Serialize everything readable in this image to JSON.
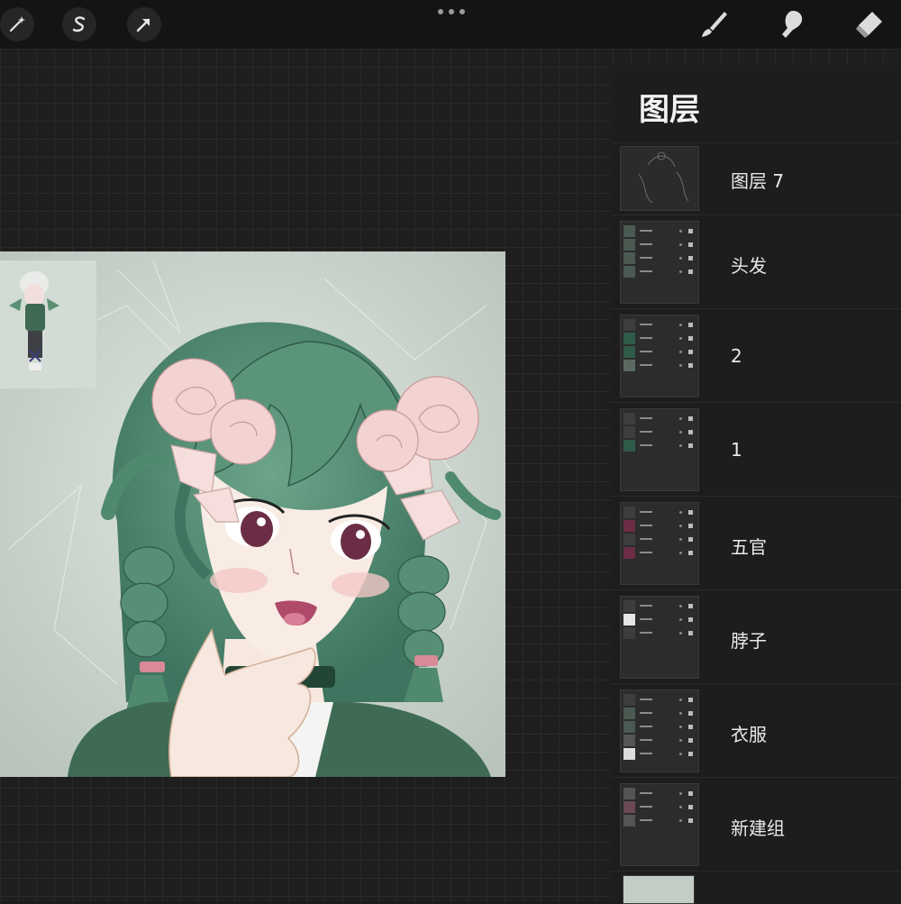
{
  "toolbar": {
    "left_buttons": [
      "magic-wand-icon",
      "selection-s-icon",
      "transform-arrow-icon"
    ],
    "right_tools": [
      "brush-icon",
      "smudge-icon",
      "eraser-icon"
    ],
    "more_icon": "more-dots-icon"
  },
  "layers_panel": {
    "title": "图层",
    "layers": [
      {
        "name": "图层 7",
        "type": "layer"
      },
      {
        "name": "头发",
        "type": "group"
      },
      {
        "name": "2",
        "type": "group"
      },
      {
        "name": "1",
        "type": "group"
      },
      {
        "name": "五官",
        "type": "group"
      },
      {
        "name": "脖子",
        "type": "group"
      },
      {
        "name": "衣服",
        "type": "group"
      },
      {
        "name": "新建组",
        "type": "group"
      }
    ]
  },
  "colors": {
    "background": "#1e1e1e",
    "toolbar": "#141414",
    "panel": "#1d1d1d",
    "hair_green": "#4f8a6f",
    "rose_pink": "#f0d3d0",
    "paper": "#c9d3cc"
  }
}
